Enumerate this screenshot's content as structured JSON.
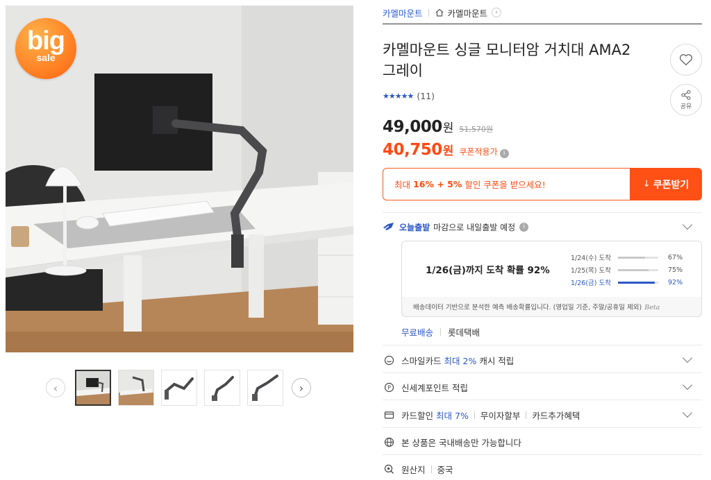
{
  "badge": {
    "big": "big",
    "sale": "sale"
  },
  "breadcrumb": {
    "brand": "카멜마운트",
    "store": "카멜마운트",
    "arrow": "›"
  },
  "product": {
    "title": "카멜마운트 싱글 모니터암 거치대 AMA2 그레이",
    "stars": "★★★★★",
    "review_count": "(11)",
    "price": "49,000",
    "price_unit": "원",
    "original_price": "51,570원",
    "coupon_price": "40,750",
    "coupon_price_unit": "원",
    "coupon_note": "쿠폰적용가"
  },
  "actions": {
    "share_label": "공유"
  },
  "coupon": {
    "msg_prefix": "최대",
    "msg_bold": "16% + 5%",
    "msg_suffix": "할인 쿠폰을 받으세요!",
    "button_label": "쿠폰받기",
    "button_icon": "↓"
  },
  "shipping": {
    "tag": "오늘출발",
    "text": "마감으로 내일출발 예정",
    "probability_main": "1/26(금)까지 도착 확률 92%",
    "probabilities": [
      {
        "date": "1/24(수) 도착",
        "pct": "67%",
        "value": 0.67
      },
      {
        "date": "1/25(목) 도착",
        "pct": "75%",
        "value": 0.75
      },
      {
        "date": "1/26(금) 도착",
        "pct": "92%",
        "value": 0.92
      }
    ],
    "note": "배송데이터 기반으로 분석한 예측 배송확률입니다. (영업일 기준, 주말/공휴일 제외)",
    "beta": "Beta",
    "free_label": "무료배송",
    "carrier": "롯데택배"
  },
  "benefits": {
    "smile": {
      "label": "스마일카드",
      "highlight": "최대 2%",
      "suffix": "캐시 적립"
    },
    "shinsegae": {
      "label": "신세계포인트 적립"
    },
    "card": {
      "label": "카드할인",
      "highlight": "최대 7%",
      "item2": "무이자할부",
      "item3": "카드추가혜택"
    },
    "domestic": {
      "label": "본 상품은 국내배송만 가능합니다"
    },
    "origin": {
      "label": "원산지",
      "value": "중국"
    }
  },
  "icons": {
    "prev": "‹",
    "next": "›",
    "info": "i"
  },
  "colors": {
    "accent_blue": "#2a56c6",
    "coupon_orange": "#ff5016"
  }
}
